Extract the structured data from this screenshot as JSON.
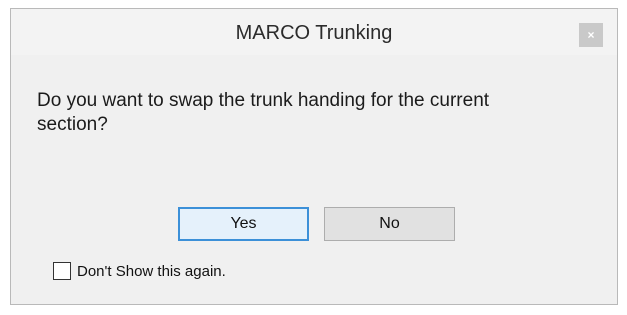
{
  "dialog": {
    "title": "MARCO Trunking",
    "close_label": "×",
    "message": "Do you want to swap the trunk handing for the current section?",
    "buttons": {
      "yes": "Yes",
      "no": "No"
    },
    "checkbox": {
      "label": "Don't Show this again.",
      "checked": false
    }
  },
  "colors": {
    "title_bar": "#f3f3f3",
    "body": "#f0f0f0",
    "default_button_border": "#3c90d8",
    "default_button_fill": "#e5f1fb",
    "close_button": "#c9c9c9"
  }
}
